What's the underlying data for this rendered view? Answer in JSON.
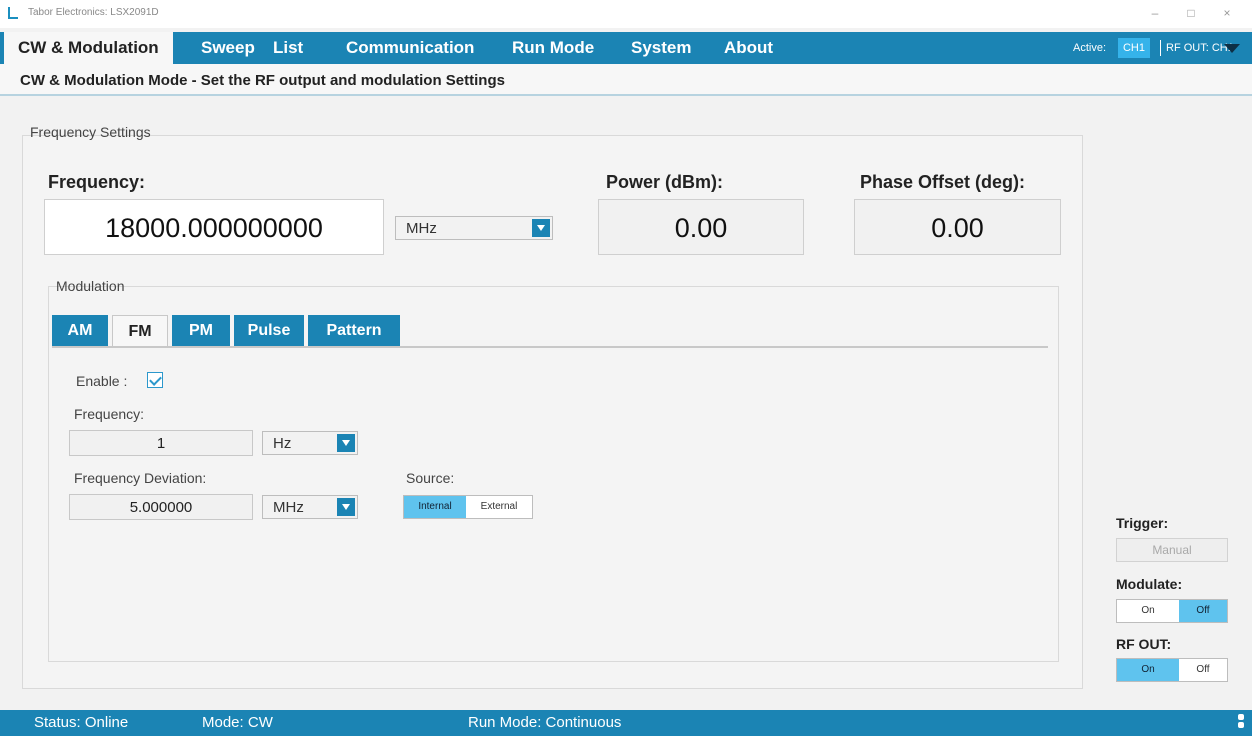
{
  "window": {
    "title": "Tabor Electronics: LSX2091D",
    "minimize": "–",
    "maximize": "□",
    "close": "×"
  },
  "nav": {
    "tabs": [
      {
        "label": "CW & Modulation"
      },
      {
        "label": "Sweep"
      },
      {
        "label": "List"
      },
      {
        "label": "Communication"
      },
      {
        "label": "Run Mode"
      },
      {
        "label": "System"
      },
      {
        "label": "About"
      }
    ],
    "active_label": "Active:",
    "active_channel": "CH1",
    "rf_out_label": "RF OUT:",
    "rf_out_channel": "CH1"
  },
  "subheader": "CW & Modulation Mode - Set the RF output and modulation Settings",
  "frequency_settings": {
    "group_title": "Frequency Settings",
    "frequency_label": "Frequency:",
    "frequency_value": "18000.000000000",
    "frequency_unit": "MHz",
    "power_label": "Power (dBm):",
    "power_value": "0.00",
    "phase_label": "Phase Offset (deg):",
    "phase_value": "0.00"
  },
  "modulation": {
    "group_title": "Modulation",
    "tabs": [
      "AM",
      "FM",
      "PM",
      "Pulse",
      "Pattern"
    ],
    "active_tab": "FM",
    "enable_label": "Enable :",
    "enabled": true,
    "frequency_label": "Frequency:",
    "frequency_value": "1",
    "frequency_unit": "Hz",
    "deviation_label": "Frequency Deviation:",
    "deviation_value": "5.000000",
    "deviation_unit": "MHz",
    "source_label": "Source:",
    "source_options": [
      "Internal",
      "External"
    ],
    "source_selected": "Internal"
  },
  "side_panel": {
    "trigger_label": "Trigger:",
    "trigger_button": "Manual",
    "modulate_label": "Modulate:",
    "modulate_options": [
      "On",
      "Off"
    ],
    "modulate_selected": "Off",
    "rf_out_label": "RF OUT:",
    "rf_out_options": [
      "On",
      "Off"
    ],
    "rf_out_selected": "On"
  },
  "status": {
    "status_text": "Status: Online",
    "mode_text": "Mode: CW",
    "run_mode_text": "Run Mode: Continuous"
  },
  "colors": {
    "accent": "#1b84b4",
    "toggle_on": "#5fc3ee",
    "badge": "#35b3ea"
  }
}
